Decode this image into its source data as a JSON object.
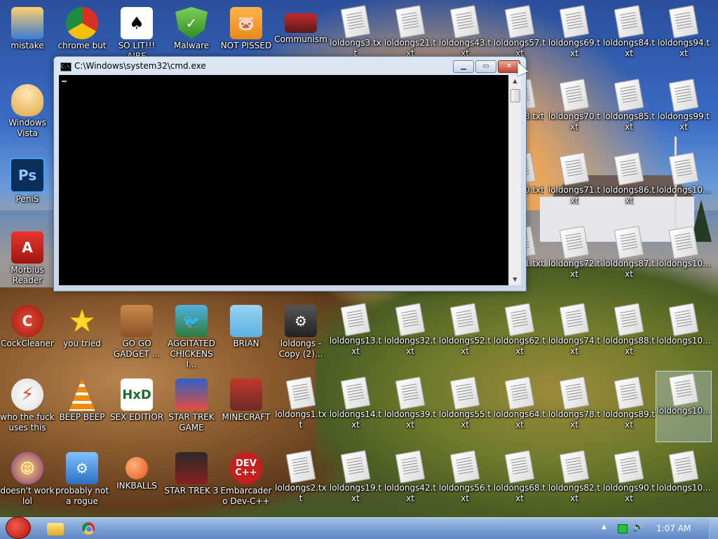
{
  "desktop": {
    "icons": {
      "mistake": {
        "label": "mistake"
      },
      "chrome": {
        "label": "chrome but"
      },
      "solit": {
        "label": "SO LIT!!! AIRE"
      },
      "malware": {
        "label": "Malware"
      },
      "notpissed": {
        "label": "NOT PISSED"
      },
      "communism": {
        "label": "Communism"
      },
      "winvista": {
        "label": "Windows Vista"
      },
      "penis": {
        "label": "PeniS"
      },
      "morbius": {
        "label": "Morbius Reader"
      },
      "cockcleaner": {
        "label": "CockCleaner"
      },
      "youtried": {
        "label": "you tried"
      },
      "gogo": {
        "label": "GO GO GADGET ..."
      },
      "aggitated": {
        "label": "AGGITATED CHICKENS I..."
      },
      "brian": {
        "label": "BRIAN"
      },
      "loldongscopy": {
        "label": "loldongs - Copy (2)..."
      },
      "whothefuck": {
        "label": "who the fuck uses this"
      },
      "beepbeep": {
        "label": "BEEP BEEP"
      },
      "sexeditior": {
        "label": "SEX EDITIOR"
      },
      "startrekgame": {
        "label": "STAR TREK GAME"
      },
      "minecraft": {
        "label": "MINECRAFT"
      },
      "doesntwork": {
        "label": "doesn't work lol"
      },
      "probablynot": {
        "label": "probably not a rogue"
      },
      "inkballs": {
        "label": "INKBALLS"
      },
      "startrek3": {
        "label": "STAR TREK 3"
      },
      "devcpp": {
        "label": "Embarcadero Dev-C++"
      }
    },
    "txt_files": {
      "r1": [
        "loldongs3.txt",
        "loldongs21.txt",
        "loldongs43.txt",
        "loldongs57.txt",
        "loldongs69.txt",
        "loldongs84.txt",
        "loldongs94.txt"
      ],
      "r2": [
        "58.txt",
        "loldongs70.txt",
        "loldongs85.txt",
        "loldongs99.txt"
      ],
      "r3": [
        "60.txt",
        "loldongs71.txt",
        "loldongs86.txt",
        "loldongs10..."
      ],
      "r4": [
        "61.txt",
        "loldongs72.txt",
        "loldongs87.txt",
        "loldongs10..."
      ],
      "r5": [
        "loldongs13.txt",
        "loldongs32.txt",
        "loldongs52.txt",
        "loldongs62.txt",
        "loldongs74.txt",
        "loldongs88.txt",
        "loldongs10..."
      ],
      "r6": [
        "loldongs1.txt",
        "loldongs14.txt",
        "loldongs39.txt",
        "loldongs55.txt",
        "loldongs64.txt",
        "loldongs78.txt",
        "loldongs89.txt",
        "loldongs10..."
      ],
      "r7": [
        "loldongs2.txt",
        "loldongs19.txt",
        "loldongs42.txt",
        "loldongs56.txt",
        "loldongs68.txt",
        "loldongs82.txt",
        "loldongs90.txt",
        "loldongs10..."
      ]
    }
  },
  "cmd_window": {
    "title": "C:\\Windows\\system32\\cmd.exe",
    "min_glyph": "▁",
    "max_glyph": "▭",
    "close_glyph": "✕",
    "icon_glyph": "C:\\",
    "scroll_up_glyph": "▲",
    "scroll_down_glyph": "▼"
  },
  "taskbar": {
    "tray_arrow": "▲",
    "volume_glyph": "🔊",
    "clock": "1:07 AM"
  },
  "colors": {
    "console_bg": "#000000",
    "close_button": "#c3442c"
  }
}
